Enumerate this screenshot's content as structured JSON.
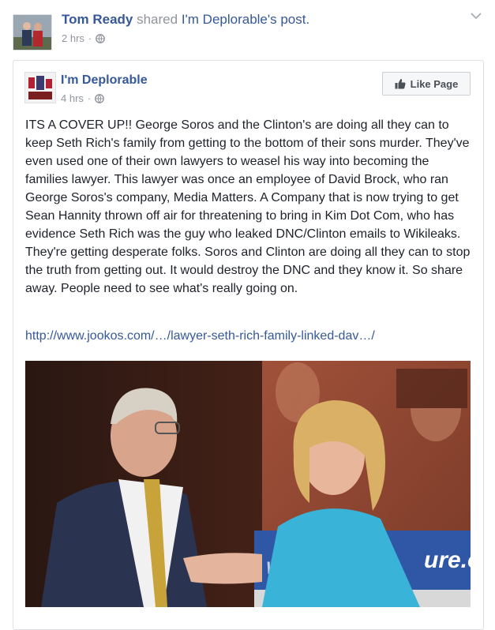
{
  "outer_post": {
    "sharer_name": "Tom Ready",
    "shared_text": " shared ",
    "shared_link_text": "I'm Deplorable's post.",
    "timestamp": "2 hrs",
    "separator": "·",
    "privacy_icon": "globe-icon",
    "menu_icon": "chevron-down-icon"
  },
  "shared_post": {
    "page_name": "I'm Deplorable",
    "timestamp": "4 hrs",
    "separator": "·",
    "privacy_icon": "globe-icon",
    "like_page_label": "Like Page",
    "like_icon": "thumbs-up-icon",
    "body": "ITS A COVER UP!! George Soros and the Clinton's are doing all they can to keep Seth Rich's family from getting to the bottom of their sons murder. They've even used one of their own lawyers to weasel his way into becoming the families lawyer. This lawyer was once an employee of David Brock, who ran George Soros's company, Media Matters. A Company that is now trying to get Sean Hannity thrown off air for threatening to bring in Kim Dot Com, who has evidence Seth Rich was the guy who leaked DNC/Clinton emails to Wikileaks. They're getting desperate folks. Soros and Clinton are doing all they can to stop the truth from getting out. It would destroy the DNC and they know it. So share away. People need to see what's really going on.",
    "link_text": "http://www.jookos.com/…/lawyer-seth-rich-family-linked-dav…/",
    "photo_banner_text": "ure.or",
    "photo_banner_left_text": "WW"
  },
  "colors": {
    "link_blue": "#365899",
    "meta_gray": "#90949c",
    "text": "#1d2129",
    "border": "#dddfe2"
  }
}
